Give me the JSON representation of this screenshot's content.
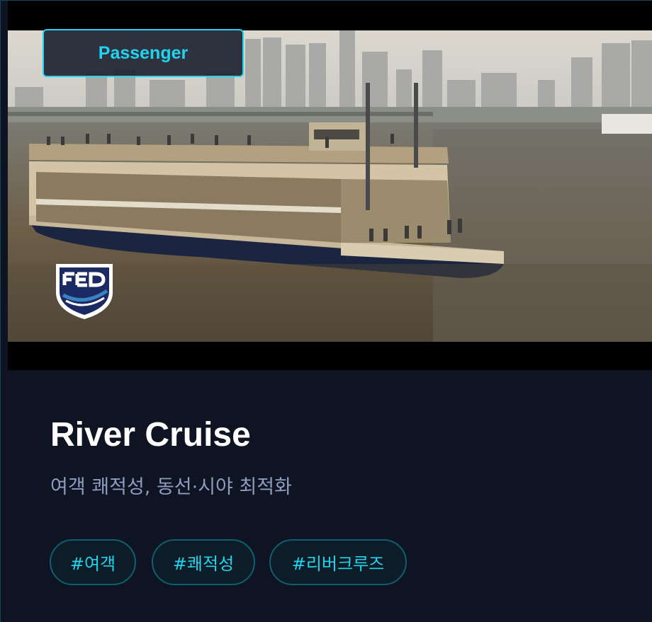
{
  "card": {
    "badge": "Passenger",
    "title": "River Cruise",
    "subtitle": "여객 쾌적성, 동선·시야 최적화",
    "tags": [
      "#여객",
      "#쾌적성",
      "#리버크루즈"
    ]
  },
  "colors": {
    "accent": "#22d3ee",
    "card_bg": "#0e1422",
    "subtitle": "#8e9cc0",
    "tag_border": "#0e5f70"
  },
  "icons": {
    "logo": "shield-logo-icon"
  }
}
